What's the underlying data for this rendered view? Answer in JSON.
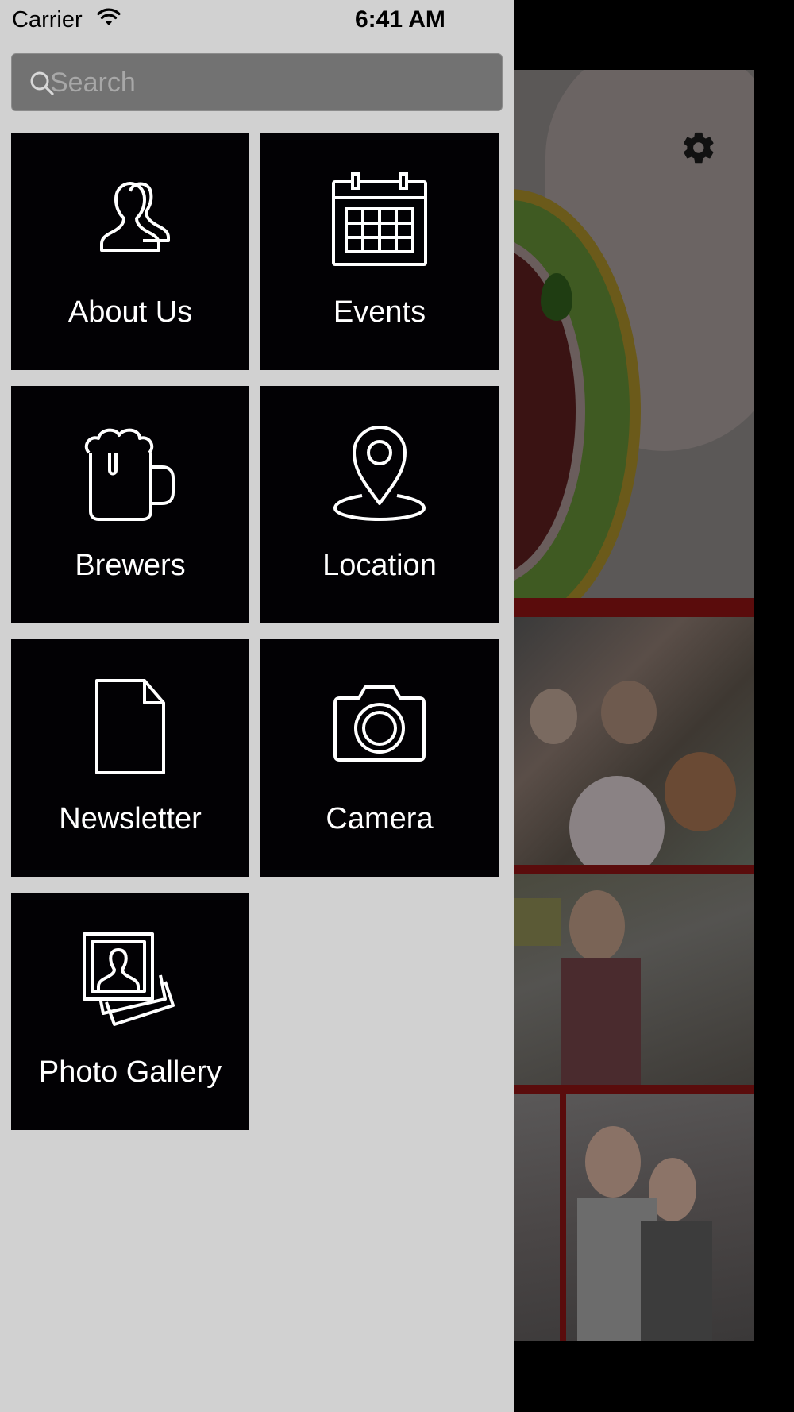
{
  "status_bar": {
    "carrier": "Carrier",
    "time": "6:41 AM"
  },
  "search": {
    "placeholder": "Search",
    "value": ""
  },
  "menu": {
    "items": [
      {
        "label": "About Us",
        "icon": "users-icon"
      },
      {
        "label": "Events",
        "icon": "calendar-icon"
      },
      {
        "label": "Brewers",
        "icon": "beer-mug-icon"
      },
      {
        "label": "Location",
        "icon": "map-pin-icon"
      },
      {
        "label": "Newsletter",
        "icon": "document-icon"
      },
      {
        "label": "Camera",
        "icon": "camera-icon"
      },
      {
        "label": "Photo Gallery",
        "icon": "photo-gallery-icon"
      }
    ]
  },
  "colors": {
    "drawer_background": "#d1d1d1",
    "tile_background": "#020104",
    "tile_text": "#ffffff",
    "search_background": "#727272",
    "accent_strip": "#5a0c0c"
  },
  "background_content": {
    "settings_icon": "gear-icon"
  }
}
